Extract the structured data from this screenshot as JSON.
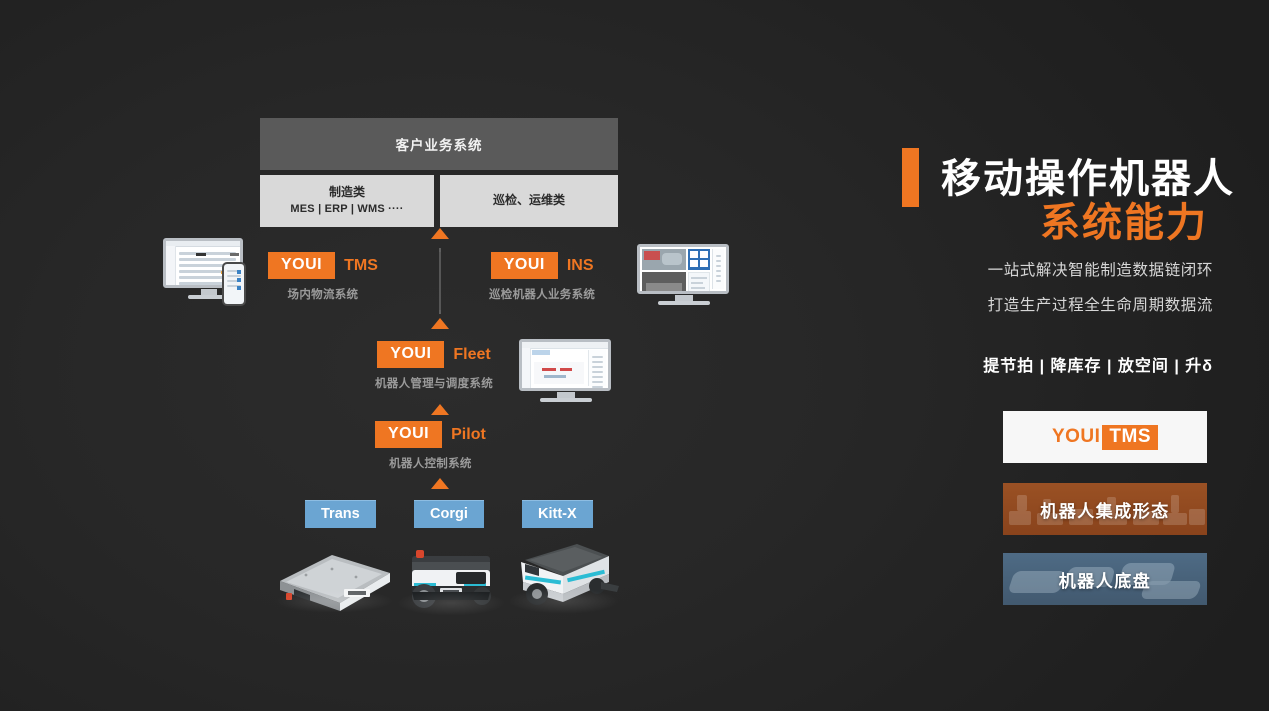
{
  "background_color": "#252525",
  "accent_color": "#ef7622",
  "blue_color": "#6ba5d2",
  "diagram": {
    "customer_system": {
      "title": "客户业务系统"
    },
    "customer_sub": [
      {
        "line1": "制造类",
        "line2": "MES | ERP | WMS ····"
      },
      {
        "line1": "巡检、运维类",
        "line2": ""
      }
    ],
    "products": [
      {
        "badge": "YOUI",
        "name": "TMS",
        "desc": "场内物流系统"
      },
      {
        "badge": "YOUI",
        "name": "INS",
        "desc": "巡检机器人业务系统"
      },
      {
        "badge": "YOUI",
        "name": "Fleet",
        "desc": "机器人管理与调度系统"
      },
      {
        "badge": "YOUI",
        "name": "Pilot",
        "desc": "机器人控制系统"
      }
    ],
    "chassis_models": [
      {
        "label": "Trans"
      },
      {
        "label": "Corgi"
      },
      {
        "label": "Kitt-X"
      }
    ],
    "screens": [
      {
        "name": "tms-desktop-and-phone"
      },
      {
        "name": "ins-monitoring-console"
      },
      {
        "name": "fleet-dispatch-console"
      }
    ]
  },
  "panel": {
    "title_line1": "移动操作机器人",
    "title_line2": "系统能力",
    "subtitle_line1": "一站式解决智能制造数据链闭环",
    "subtitle_line2": "打造生产过程全生命周期数据流",
    "kpi_line": "提节拍 | 降库存 | 放空间 | 升δ",
    "cards": [
      {
        "id": "tms",
        "logo_left": "YOUI",
        "logo_right": "TMS",
        "label": ""
      },
      {
        "id": "integration",
        "label": "机器人集成形态"
      },
      {
        "id": "chassis",
        "label": "机器人底盘"
      }
    ]
  }
}
